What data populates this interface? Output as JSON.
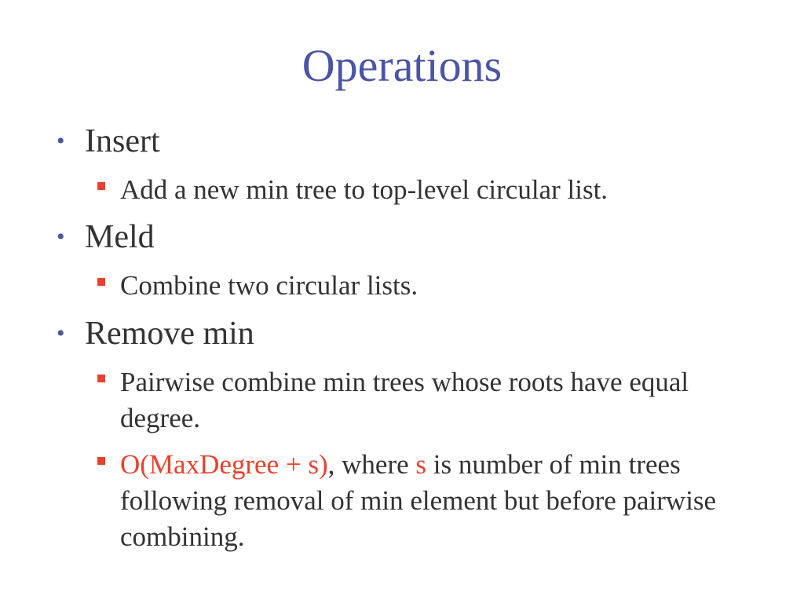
{
  "slide": {
    "title": "Operations",
    "colors": {
      "title": "#4b55a5",
      "bullet_dot": "#4b55a5",
      "bullet_square": "#e8412e",
      "highlight": "#e8412e",
      "body_text": "#333333"
    },
    "items": [
      {
        "label": "Insert",
        "sub": [
          "Add a new min tree to top-level circular list."
        ]
      },
      {
        "label": "Meld",
        "sub": [
          "Combine two circular lists."
        ]
      },
      {
        "label": "Remove min",
        "sub": [
          "Pairwise combine min trees whose roots have equal degree.",
          {
            "part1": "O(MaxDegree + s)",
            "part2": ", where ",
            "part3": "s",
            "part4": " is number of min trees following removal of min element but before pairwise combining."
          }
        ]
      }
    ]
  }
}
